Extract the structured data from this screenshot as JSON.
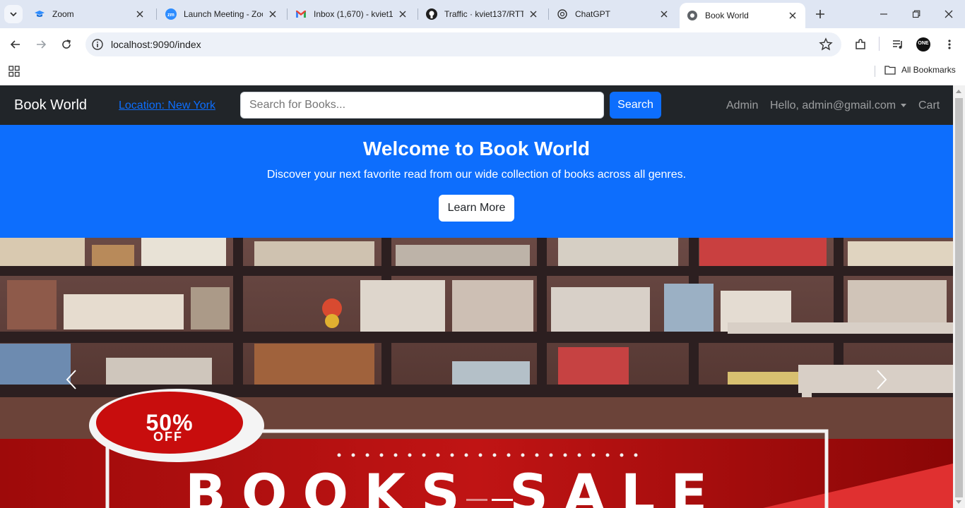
{
  "browser": {
    "tabs": [
      {
        "title": "Zoom",
        "icon": "zoom-cap-icon"
      },
      {
        "title": "Launch Meeting - Zoom",
        "icon": "zoom-icon"
      },
      {
        "title": "Inbox (1,670) - kviet1",
        "icon": "gmail-icon"
      },
      {
        "title": "Traffic · kviet137/RTT",
        "icon": "github-icon"
      },
      {
        "title": "ChatGPT",
        "icon": "chatgpt-icon"
      },
      {
        "title": "Book World",
        "icon": "globe-icon"
      }
    ],
    "active_tab": 5,
    "url": "localhost:9090/index",
    "bookmarks_label": "All Bookmarks",
    "profile_badge": "ONE"
  },
  "site": {
    "brand": "Book World",
    "location": "Location: New York",
    "search_placeholder": "Search for Books...",
    "search_button": "Search",
    "nav": {
      "admin": "Admin",
      "user": "Hello, admin@gmail.com",
      "cart": "Cart"
    },
    "hero": {
      "title": "Welcome to Book World",
      "subtitle": "Discover your next favorite read from our wide collection of books across all genres.",
      "button": "Learn More"
    },
    "carousel": {
      "badge_percent": "50%",
      "badge_off": "OFF",
      "banner_text": "BOOKS SALE",
      "slide_count": 2,
      "active_slide": 1
    },
    "colors": {
      "navbar": "#212529",
      "primary": "#0d6efd",
      "sale_red": "#b30000"
    }
  }
}
